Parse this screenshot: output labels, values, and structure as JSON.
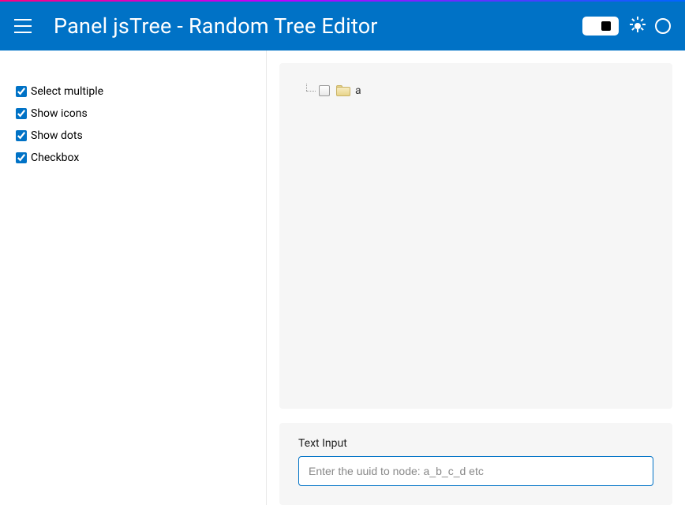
{
  "header": {
    "title": "Panel jsTree  -  Random Tree Editor"
  },
  "sidebar": {
    "options": [
      {
        "label": "Select multiple",
        "checked": true
      },
      {
        "label": "Show icons",
        "checked": true
      },
      {
        "label": "Show dots",
        "checked": true
      },
      {
        "label": "Checkbox",
        "checked": true
      }
    ]
  },
  "tree": {
    "root_label": "a"
  },
  "text_input": {
    "label": "Text Input",
    "placeholder": "Enter the uuid to node: a_b_c_d etc",
    "value": ""
  }
}
